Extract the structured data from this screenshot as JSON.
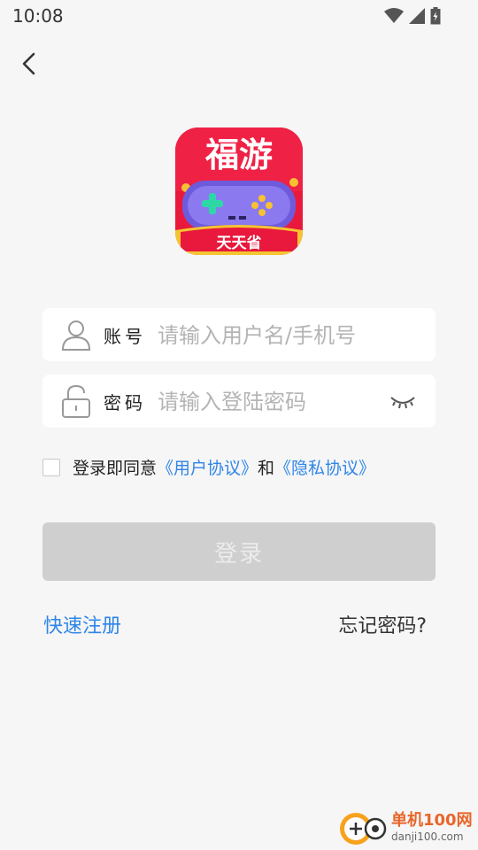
{
  "status": {
    "time": "10:08"
  },
  "logo": {
    "line1": "福游",
    "ribbon": "天天省"
  },
  "account": {
    "label": "账号",
    "placeholder": "请输入用户名/手机号"
  },
  "password": {
    "label": "密码",
    "placeholder": "请输入登陆密码"
  },
  "agreement": {
    "prefix": "登录即同意",
    "user_agreement": "《用户协议》",
    "conjunction": "和",
    "privacy_policy": "《隐私协议》"
  },
  "login_button": "登录",
  "register_link": "快速注册",
  "forgot_link": "忘记密码?",
  "watermark": {
    "name": "单机100网",
    "url": "danji100.com"
  },
  "colors": {
    "link": "#2f86e8",
    "background": "#f6f6f6",
    "button_disabled": "#cfcfcf",
    "logo_red": "#e8193c",
    "logo_purple": "#6e5bdc"
  }
}
